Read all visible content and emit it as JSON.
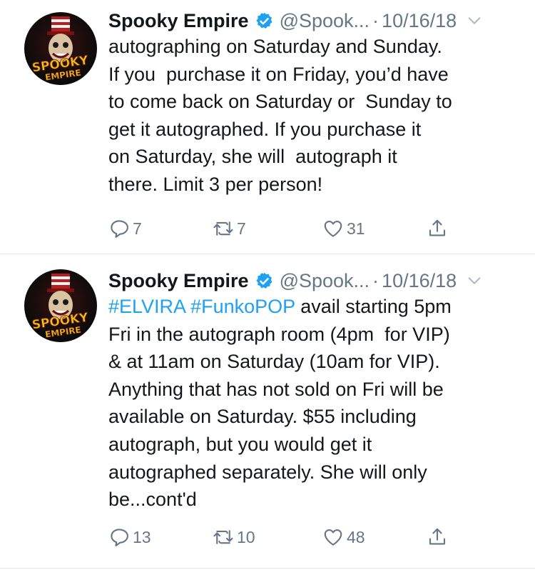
{
  "colors": {
    "accent": "#1da1f2",
    "muted": "#657786",
    "text": "#14171a",
    "divider": "#e1e8ed"
  },
  "tweets": [
    {
      "display_name": "Spooky Empire",
      "handle": "@Spook...",
      "date": "10/16/18",
      "avatar_text_top": "SPOOKY",
      "avatar_text_bottom": "EMPIRE",
      "text": "autographing on Saturday and Sunday.\nIf you  purchase it on Friday, you’d have\nto come back on Saturday or  Sunday to\nget it autographed. If you purchase it\non Saturday, she will  autograph it\nthere. Limit 3 per person!",
      "hashtags": [],
      "replies": "7",
      "retweets": "7",
      "likes": "31"
    },
    {
      "display_name": "Spooky Empire",
      "handle": "@Spook...",
      "date": "10/16/18",
      "avatar_text_top": "SPOOKY",
      "avatar_text_bottom": "EMPIRE",
      "hashtags": [
        "#ELVIRA",
        "#FunkoPOP"
      ],
      "text": " avail starting 5pm\nFri in the autograph room (4pm  for VIP)\n& at 11am on Saturday (10am for VIP).\nAnything that has not sold on Fri will be\navailable on Saturday. $55 including\nautograph, but you would get it\nautographed separately. She will only\nbe...cont'd",
      "replies": "13",
      "retweets": "10",
      "likes": "48"
    }
  ],
  "icons": {
    "verified": "verified-badge-icon",
    "chevron": "chevron-down-icon",
    "reply": "reply-icon",
    "retweet": "retweet-icon",
    "like": "heart-icon",
    "share": "share-icon"
  },
  "dot_separator": "·"
}
